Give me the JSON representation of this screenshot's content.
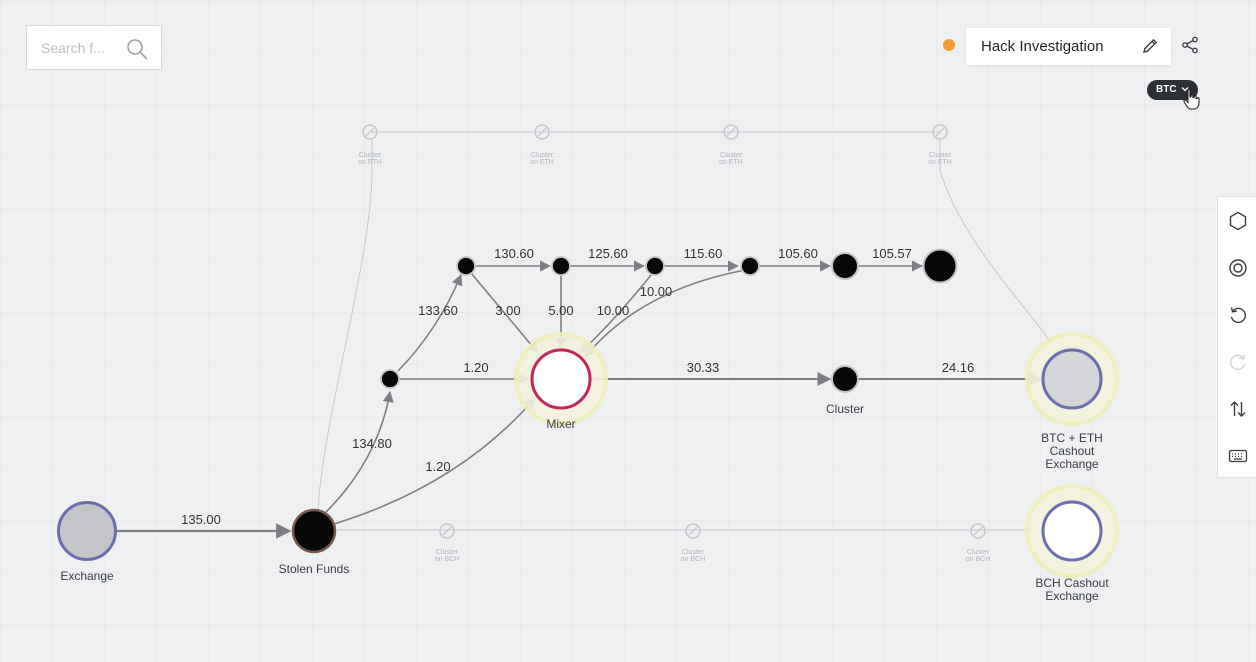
{
  "search": {
    "placeholder": "Search f..."
  },
  "header": {
    "case_title": "Hack Investigation",
    "status_color": "#f29c38",
    "currency": "BTC",
    "currency_bg": "#2d3034"
  },
  "toolbar": {
    "items": [
      {
        "name": "hexagon-icon"
      },
      {
        "name": "target-icon"
      },
      {
        "name": "undo-icon"
      },
      {
        "name": "redo-icon"
      },
      {
        "name": "swap-vertical-icon"
      },
      {
        "name": "keyboard-icon"
      }
    ]
  },
  "graph": {
    "colors": {
      "edge": "#7d7f83",
      "ghost": "#c7c9cc",
      "node_dark": "#080808",
      "exchange_ring": "#6a6fb0",
      "exchange_fill": "#c4c5c8",
      "mixer_ring": "#c3265a",
      "halo": "#f1efb9"
    },
    "nodes": [
      {
        "id": "exchange",
        "label": "Exchange"
      },
      {
        "id": "stolen",
        "label": "Stolen Funds"
      },
      {
        "id": "mixer",
        "label": "Mixer"
      },
      {
        "id": "cluster",
        "label": "Cluster"
      },
      {
        "id": "btceth",
        "label": "BTC + ETH",
        "label2": "Cashout",
        "label3": "Exchange"
      },
      {
        "id": "bch",
        "label": "BCH Cashout",
        "label2": "Exchange"
      }
    ],
    "edges": [
      {
        "id": "e1",
        "value": "135.00"
      },
      {
        "id": "e2",
        "value": "134.80"
      },
      {
        "id": "e3",
        "value": "1.20"
      },
      {
        "id": "e4",
        "value": "133.60"
      },
      {
        "id": "e5",
        "value": "1.20"
      },
      {
        "id": "e6",
        "value": "130.60"
      },
      {
        "id": "e7",
        "value": "125.60"
      },
      {
        "id": "e8",
        "value": "115.60"
      },
      {
        "id": "e9",
        "value": "105.60"
      },
      {
        "id": "e10",
        "value": "105.57"
      },
      {
        "id": "e11",
        "value": "3.00"
      },
      {
        "id": "e12",
        "value": "5.00"
      },
      {
        "id": "e13",
        "value": "10.00"
      },
      {
        "id": "e14",
        "value": "10.00"
      },
      {
        "id": "e15",
        "value": "30.33"
      },
      {
        "id": "e16",
        "value": "24.16"
      }
    ],
    "ghost_nodes": [
      {
        "id": "g1",
        "line1": "Cluster",
        "line2": "on ETH"
      },
      {
        "id": "g2",
        "line1": "Cluster",
        "line2": "on ETH"
      },
      {
        "id": "g3",
        "line1": "Cluster",
        "line2": "on ETH"
      },
      {
        "id": "g4",
        "line1": "Cluster",
        "line2": "on ETH"
      },
      {
        "id": "g5",
        "line1": "Cluster",
        "line2": "on BCH"
      },
      {
        "id": "g6",
        "line1": "Cluster",
        "line2": "on BCH"
      },
      {
        "id": "g7",
        "line1": "Cluster",
        "line2": "on BCH"
      }
    ]
  }
}
